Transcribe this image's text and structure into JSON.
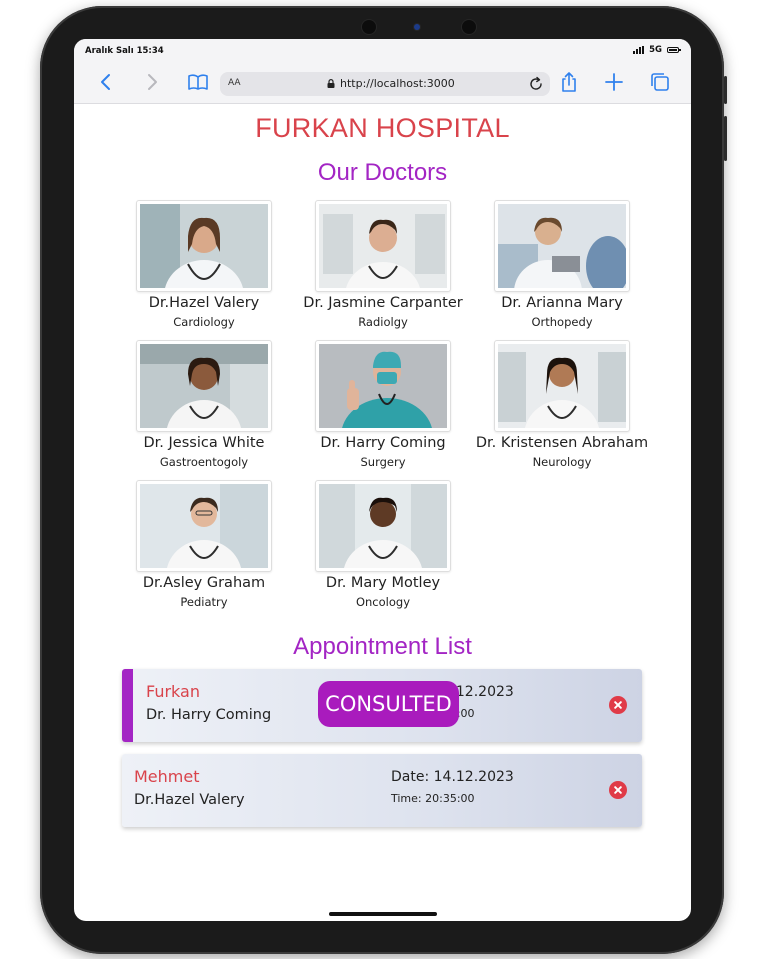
{
  "status_bar": {
    "time": "Aralık Salı 15:34",
    "network": "5G"
  },
  "browser": {
    "text_size_label": "AA",
    "url": "http://localhost:3000"
  },
  "page": {
    "title": "FURKAN HOSPITAL",
    "doctors_heading": "Our Doctors",
    "appointments_heading": "Appointment List"
  },
  "doctors": [
    {
      "name": "Dr.Hazel Valery",
      "specialty": "Cardiology"
    },
    {
      "name": "Dr. Jasmine Carpanter",
      "specialty": "Radiolgy"
    },
    {
      "name": "Dr. Arianna Mary",
      "specialty": "Orthopedy"
    },
    {
      "name": "Dr. Jessica White",
      "specialty": "Gastroentogoly"
    },
    {
      "name": "Dr. Harry Coming",
      "specialty": "Surgery"
    },
    {
      "name": "Dr. Kristensen Abraham",
      "specialty": "Neurology"
    },
    {
      "name": "Dr.Asley Graham",
      "specialty": "Pediatry"
    },
    {
      "name": "Dr. Mary Motley",
      "specialty": "Oncology"
    }
  ],
  "appointments": [
    {
      "patient": "Furkan",
      "doctor": "Dr. Harry Coming",
      "date": "Date: 14.12.2023",
      "time": "Time: 20:35:00",
      "status": "CONSULTED"
    },
    {
      "patient": "Mehmet",
      "doctor": "Dr.Hazel Valery",
      "date": "Date: 14.12.2023",
      "time": "Time: 20:35:00"
    }
  ],
  "icons": {
    "back": "chevron-left-icon",
    "forward": "chevron-right-icon",
    "bookmarks": "book-icon",
    "lock": "lock-icon",
    "reload": "reload-icon",
    "share": "share-icon",
    "new_tab": "plus-icon",
    "tabs": "tabs-icon",
    "delete": "delete-circle-icon"
  },
  "colors": {
    "title": "#d9434b",
    "heading": "#a325c4",
    "badge": "#a91bbd",
    "delete": "#e03b48",
    "browser_accent": "#2f80ed"
  }
}
